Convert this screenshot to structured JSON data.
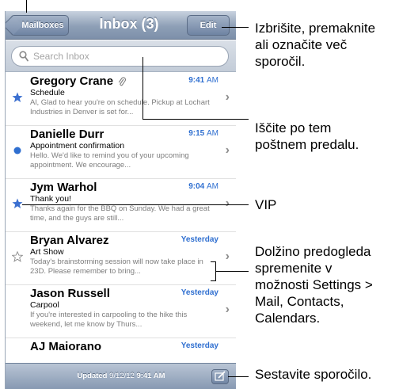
{
  "navbar": {
    "back_label": "Mailboxes",
    "title": "Inbox (3)",
    "edit_label": "Edit"
  },
  "search": {
    "placeholder": "Search Inbox"
  },
  "messages": [
    {
      "sender": "Gregory Crane",
      "time": "9:41",
      "ampm": "AM",
      "subject": "Schedule",
      "preview": "Al, Glad to hear you're on schedule. Pickup at Lochart Industries in Denver is set for...",
      "mark": "star",
      "attachment": true
    },
    {
      "sender": "Danielle Durr",
      "time": "9:15",
      "ampm": "AM",
      "subject": "Appointment confirmation",
      "preview": "Hello. We'd like to remind you of your upcoming appointment. We encourage...",
      "mark": "unread-dot",
      "attachment": false
    },
    {
      "sender": "Jym Warhol",
      "time": "9:04",
      "ampm": "AM",
      "subject": "Thank you!",
      "preview": "Thanks again for the BBQ on Sunday. We had a great time, and the guys are still...",
      "mark": "star",
      "attachment": false
    },
    {
      "sender": "Bryan Alvarez",
      "time": "Yesterday",
      "ampm": "",
      "subject": "Art Show",
      "preview": "Today's brainstorming session will now take place in 23D. Please remember to bring...",
      "mark": "star-outline",
      "attachment": false
    },
    {
      "sender": "Jason Russell",
      "time": "Yesterday",
      "ampm": "",
      "subject": "Carpool",
      "preview": "If you're interested in carpooling to the hike this weekend, let me know by Thurs...",
      "mark": "none",
      "attachment": false
    },
    {
      "sender": "AJ Maiorano",
      "time": "Yesterday",
      "ampm": "",
      "subject": "",
      "preview": "",
      "mark": "none",
      "attachment": false
    }
  ],
  "toolbar": {
    "updated_prefix": "Updated",
    "updated_date": "9/12/12",
    "updated_time": "9:41 AM"
  },
  "callouts": {
    "edit": [
      "Izbrišite, premaknite",
      "ali označite več",
      "sporočil."
    ],
    "search": [
      "Iščite po tem",
      "poštnem predalu."
    ],
    "vip": [
      "VIP"
    ],
    "preview": [
      "Dolžino predogleda",
      "spremenite v",
      "možnosti Settings >",
      "Mail, Contacts,",
      "Calendars."
    ],
    "compose": [
      "Sestavite sporočilo."
    ]
  },
  "colors": {
    "accent": "#2f6fd0",
    "star": "#3b6fd0",
    "unread_dot": "#2f6fd0",
    "navbar": "#8e9fb6"
  },
  "icons": {
    "search": "search-icon",
    "attachment": "paperclip-icon",
    "compose": "compose-icon",
    "chevron": "chevron-right-icon"
  }
}
